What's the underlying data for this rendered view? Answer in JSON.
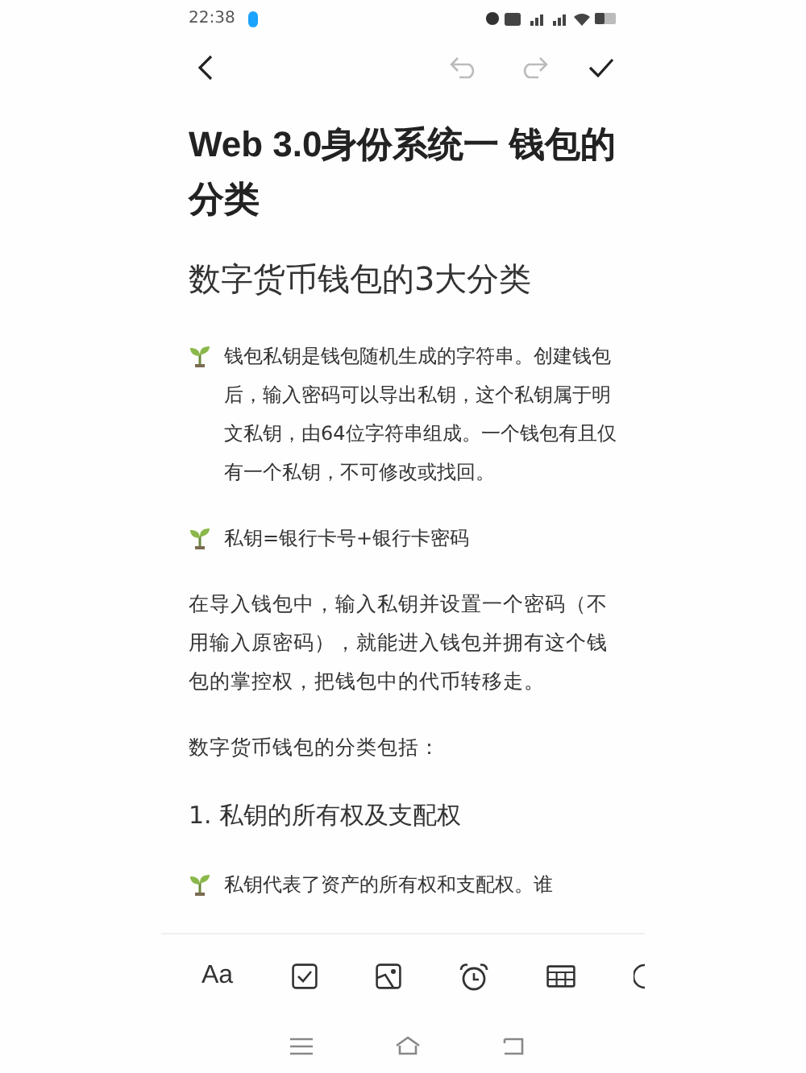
{
  "status_bar": {
    "time": "22:38"
  },
  "toolbar": {
    "undo": {
      "disabled": true
    },
    "redo": {
      "disabled": true
    }
  },
  "blocks": [
    {
      "kind": "title",
      "text": "Web  3.0身份系统一  钱包的分类"
    },
    {
      "kind": "heading",
      "text": "数字货币钱包的3大分类"
    },
    {
      "kind": "sprout",
      "text": "钱包私钥是钱包随机生成的字符串。创建钱包后，输入密码可以导出私钥，这个私钥属于明文私钥，由64位字符串组成。一个钱包有且仅有一个私钥，不可修改或找回。"
    },
    {
      "kind": "sprout",
      "text": "私钥=银行卡号+银行卡密码"
    },
    {
      "kind": "para",
      "text": "在导入钱包中，输入私钥并设置一个密码（不用输入原密码），就能进入钱包并拥有这个钱包的掌控权，把钱包中的代币转移走。"
    },
    {
      "kind": "para",
      "text": "数字货币钱包的分类包括："
    },
    {
      "kind": "numbered",
      "text": "1.  私钥的所有权及支配权"
    },
    {
      "kind": "sprout",
      "text": "私钥代表了资产的所有权和支配权。谁"
    }
  ],
  "format_bar": {
    "font_button": "Aa"
  }
}
